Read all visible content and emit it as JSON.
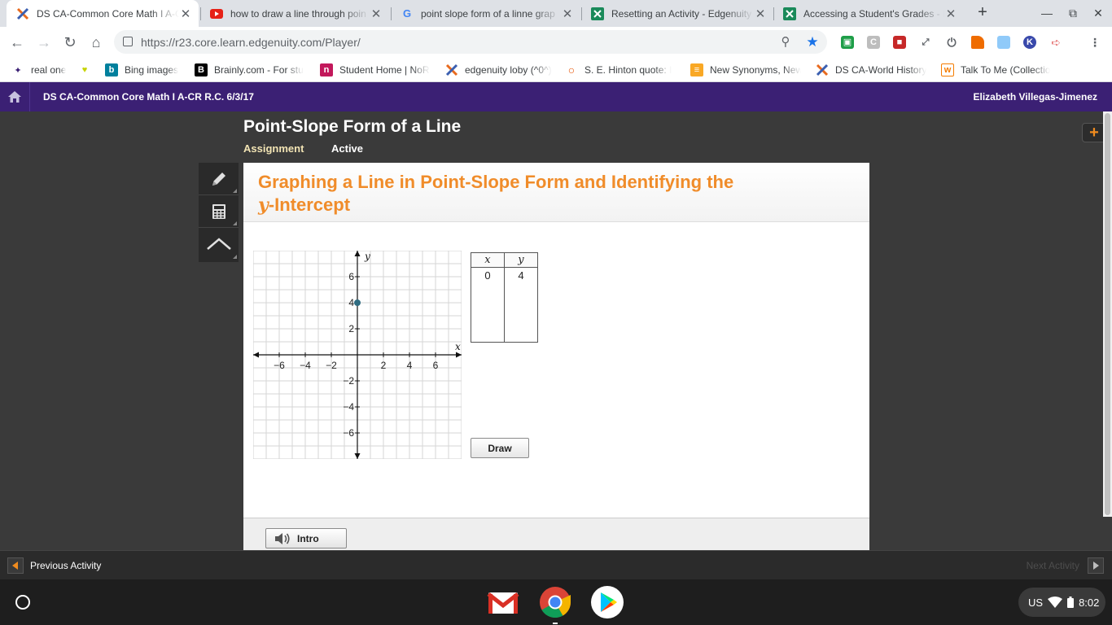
{
  "browser": {
    "tabs": [
      {
        "title": "DS CA-Common Core Math I A-C",
        "icon": "edgenuity-x-icon",
        "active": true
      },
      {
        "title": "how to draw a line through poin",
        "icon": "youtube-icon",
        "active": false
      },
      {
        "title": "point slope form of a linne grap",
        "icon": "google-icon",
        "active": false
      },
      {
        "title": "Resetting an Activity - Edgenuity",
        "icon": "green-x-icon",
        "active": false
      },
      {
        "title": "Accessing a Student's Grades - E",
        "icon": "green-x-icon",
        "active": false
      }
    ],
    "url": "https://r23.core.learn.edgenuity.com/Player/"
  },
  "bookmarks": [
    {
      "label": "real one",
      "icon": "star-logo-icon"
    },
    {
      "label": "",
      "icon": "heart-icon"
    },
    {
      "label": "Bing images",
      "icon": "bing-icon"
    },
    {
      "label": "Brainly.com - For stu",
      "icon": "brainly-icon"
    },
    {
      "label": "Student Home | NoR",
      "icon": "noredink-icon"
    },
    {
      "label": "edgenuity loby (^0^)",
      "icon": "edgenuity-x-icon"
    },
    {
      "label": "S. E. Hinton quote: I",
      "icon": "quote-icon"
    },
    {
      "label": "New Synonyms, New",
      "icon": "thesaurus-icon"
    },
    {
      "label": "DS CA-World History",
      "icon": "edgenuity-x-icon"
    },
    {
      "label": "Talk  To Me (Collectio",
      "icon": "wattpad-icon"
    }
  ],
  "header": {
    "course": "DS CA-Common Core Math I A-CR R.C. 6/3/17",
    "user": "Elizabeth Villegas-Jimenez"
  },
  "lesson": {
    "title": "Point-Slope Form of a Line",
    "type": "Assignment",
    "status": "Active"
  },
  "activity": {
    "title_line1": "Graphing a Line in Point-Slope Form and Identifying the",
    "title_var": "y",
    "title_line2_rest": "-Intercept",
    "graph": {
      "x_label": "x",
      "y_label": "y",
      "x_ticks": [
        -6,
        -4,
        -2,
        2,
        4,
        6
      ],
      "y_ticks": [
        6,
        4,
        2,
        -2,
        -4,
        -6
      ],
      "x_range": [
        -8,
        8
      ],
      "y_range": [
        -8,
        8
      ],
      "points": [
        {
          "x": 0,
          "y": 4
        }
      ],
      "point_color": "#2e6b80"
    },
    "table": {
      "headers": [
        "x",
        "y"
      ],
      "rows": [
        [
          "0",
          "4"
        ]
      ]
    },
    "draw_label": "Draw",
    "intro_label": "Intro"
  },
  "nav": {
    "prev_label": "Previous Activity",
    "next_label": "Next Activity"
  },
  "system": {
    "locale": "US",
    "time": "8:02"
  },
  "colors": {
    "header_purple": "#3b2074",
    "title_orange": "#f08c2a",
    "assignment_tan": "#f2e4b4"
  }
}
